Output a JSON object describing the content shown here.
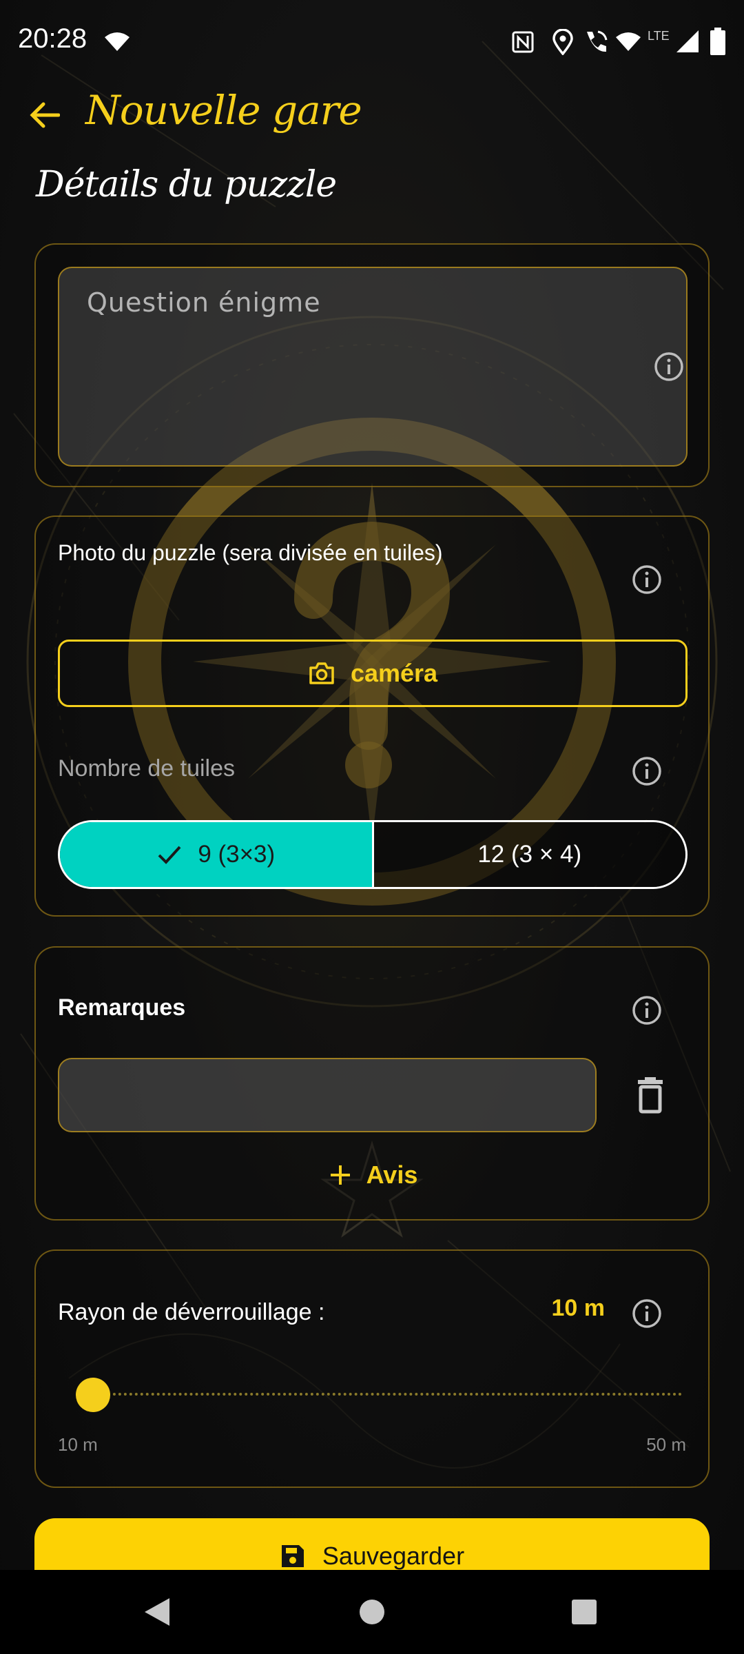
{
  "status_bar": {
    "time": "20:28",
    "icons": [
      "wifi-icon",
      "nfc-icon",
      "location-icon",
      "wifi-calling-icon",
      "wifi-icon",
      "lte-signal-icon",
      "battery-icon"
    ],
    "lte_label": "LTE"
  },
  "header": {
    "title": "Nouvelle gare",
    "back_icon": "arrow-back-icon"
  },
  "section": {
    "title": "Détails du puzzle"
  },
  "question": {
    "placeholder": "Question énigme",
    "value": ""
  },
  "photo": {
    "label": "Photo du puzzle (sera divisée en tuiles)",
    "camera_button": "caméra"
  },
  "tiles": {
    "label": "Nombre de tuiles",
    "options": [
      "9 (3×3)",
      "12 (3 × 4)"
    ],
    "selected_index": 0
  },
  "remarks": {
    "label": "Remarques",
    "input_value": "",
    "add_button": "Avis"
  },
  "radius": {
    "label": "Rayon de déverrouillage :",
    "value": "10 m",
    "min_label": "10 m",
    "max_label": "50 m",
    "level": 0
  },
  "save_button": "Sauvegarder",
  "colors": {
    "accent": "#f5cf1c",
    "selected_segment": "#00d2c1",
    "save_button": "#fdd204"
  }
}
